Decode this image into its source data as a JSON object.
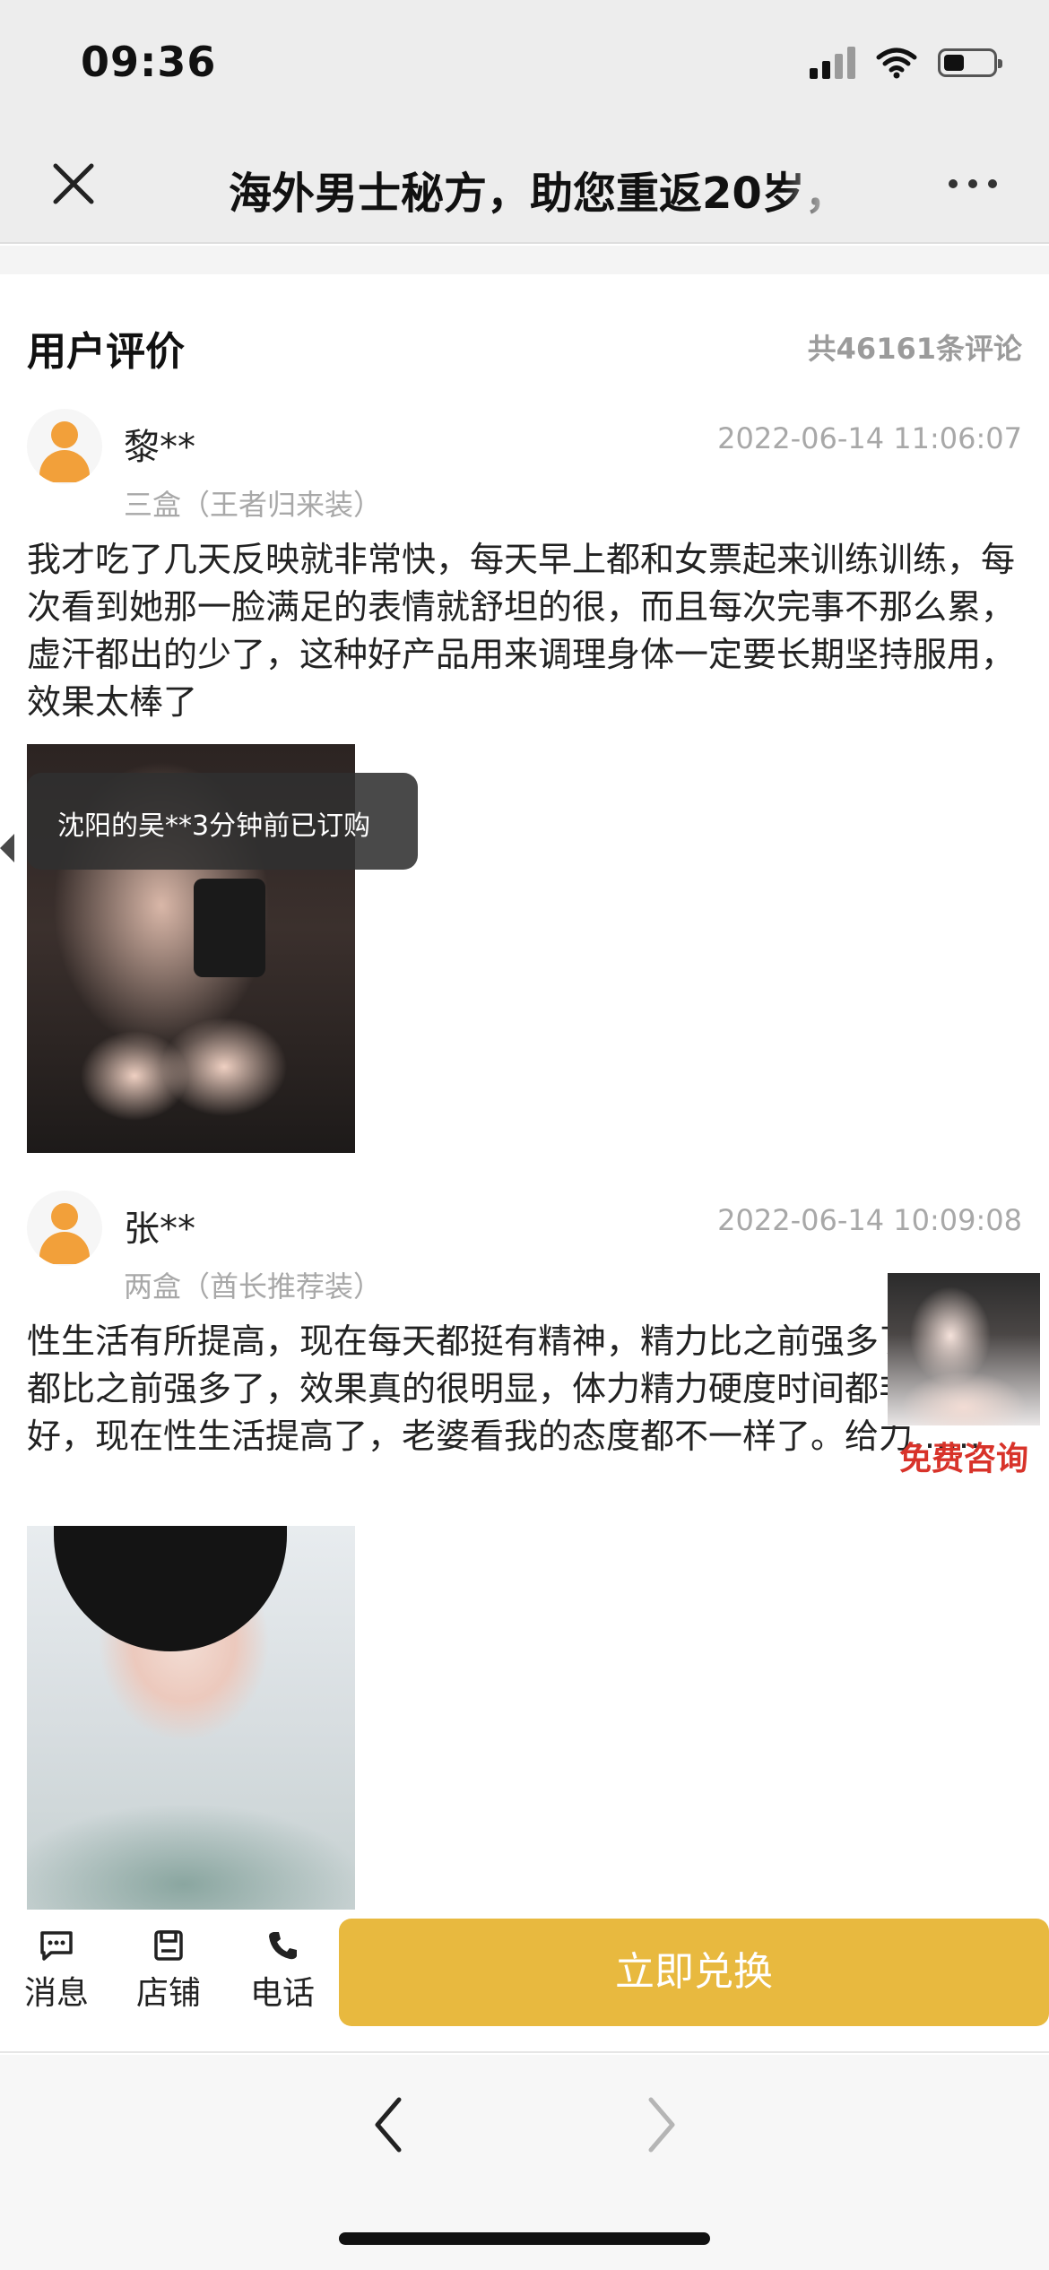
{
  "status_bar": {
    "time": "09:36"
  },
  "nav": {
    "title": "海外男士秘方，助您重返20岁，"
  },
  "reviews_section": {
    "title": "用户评价",
    "count": "共46161条评论",
    "reviews": [
      {
        "name": "黎**",
        "date": "2022-06-14 11:06:07",
        "package": "三盒（王者归来装）",
        "text": "我才吃了几天反映就非常快，每天早上都和女票起来训练训练，每次看到她那一脸满足的表情就舒坦的很，而且每次完事不那么累，虚汗都出的少了，这种好产品用来调理身体一定要长期坚持服用，效果太棒了"
      },
      {
        "name": "张**",
        "date": "2022-06-14 10:09:08",
        "package": "两盒（酋长推荐装）",
        "text": "性生活有所提高，现在每天都挺有精神，精力比之前强多了，体质都比之前强多了，效果真的很明显，体力精力硬度时间都非常的好，现在性生活提高了，老婆看我的态度都不一样了。给力……"
      }
    ]
  },
  "toast": {
    "text": "沈阳的吴**3分钟前已订购"
  },
  "floating_consult": {
    "label": "免费咨询"
  },
  "action_bar": {
    "message_label": "消息",
    "shop_label": "店铺",
    "phone_label": "电话",
    "redeem_label": "立即兑换",
    "accent_color": "#e8b93f"
  },
  "icons": [
    "close-icon",
    "more-icon",
    "message-icon",
    "shop-icon",
    "phone-icon",
    "back-arrow-icon",
    "forward-arrow-icon"
  ]
}
